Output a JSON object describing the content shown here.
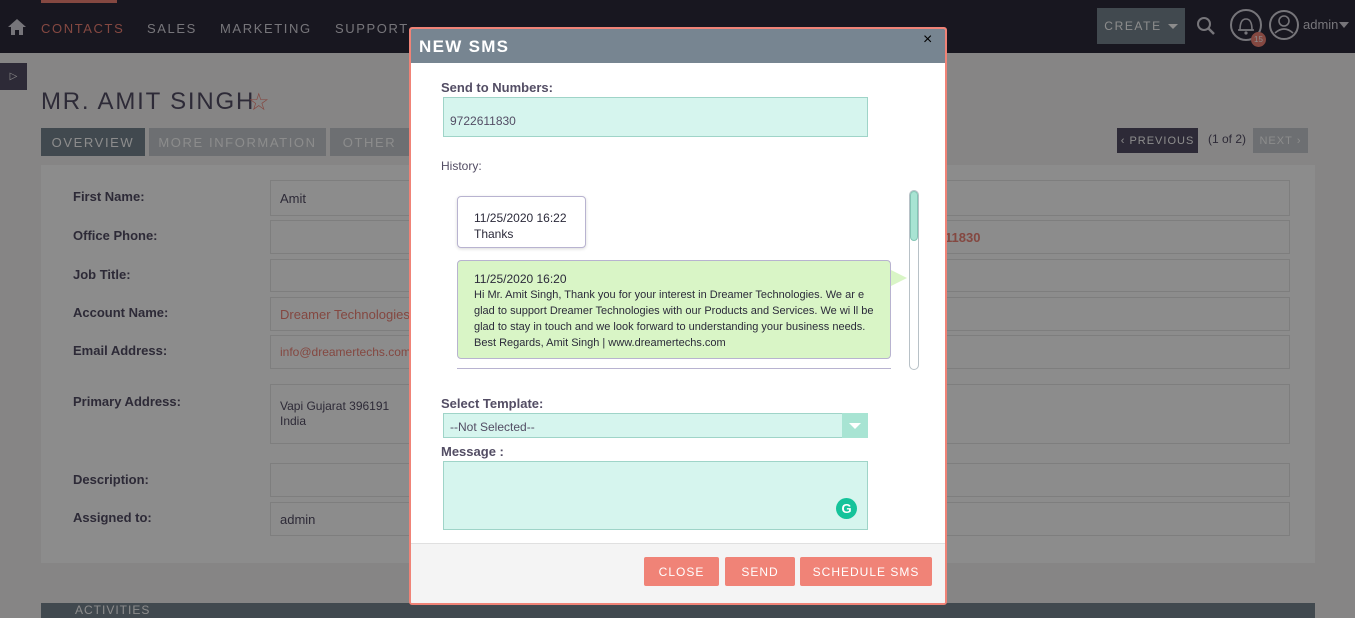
{
  "nav": {
    "items": [
      "CONTACTS",
      "SALES",
      "MARKETING",
      "SUPPORT"
    ],
    "create_label": "CREATE",
    "notification_count": "15",
    "user": "admin"
  },
  "record": {
    "title": "MR. AMIT SINGH",
    "tabs": [
      "OVERVIEW",
      "MORE INFORMATION",
      "OTHER"
    ],
    "pager": {
      "previous": "PREVIOUS",
      "count": "(1 of 2)",
      "next": "NEXT"
    },
    "fields": {
      "first_name_label": "First Name:",
      "first_name": "Amit",
      "office_phone_label": "Office Phone:",
      "mobile_partial": "11830",
      "job_title_label": "Job Title:",
      "account_name_label": "Account Name:",
      "account_name": "Dreamer Technologies",
      "email_label": "Email Address:",
      "email": "info@dreamertechs.com",
      "primary_address_label": "Primary Address:",
      "address_line1": "Vapi Gujarat  396191",
      "address_line2": "India",
      "description_label": "Description:",
      "assigned_label": "Assigned to:",
      "assigned_to": "admin"
    },
    "activities_label": "ACTIVITIES"
  },
  "modal": {
    "title": "NEW SMS",
    "close_x": "×",
    "send_to_label": "Send to Numbers:",
    "send_to_value": "9722611830",
    "history_label": "History:",
    "history": [
      {
        "timestamp": "11/25/2020 16:22",
        "text": "Thanks"
      },
      {
        "timestamp": "11/25/2020 16:20",
        "text": "Hi Mr. Amit Singh, Thank you for your interest in Dreamer Technologies. We ar e glad to support Dreamer Technologies with our Products and Services. We wi ll be glad to stay in touch and we look forward to understanding your business needs. Best Regards, Amit Singh | www.dreamertechs.com"
      }
    ],
    "template_label": "Select Template:",
    "template_value": "--Not Selected--",
    "message_label": "Message :",
    "buttons": {
      "close": "CLOSE",
      "send": "SEND",
      "schedule": "SCHEDULE SMS"
    }
  },
  "colors": {
    "accent": "#f08377",
    "header": "#778591",
    "nav_bg": "#2d2a3b",
    "input_bg": "#d6f5ee"
  }
}
